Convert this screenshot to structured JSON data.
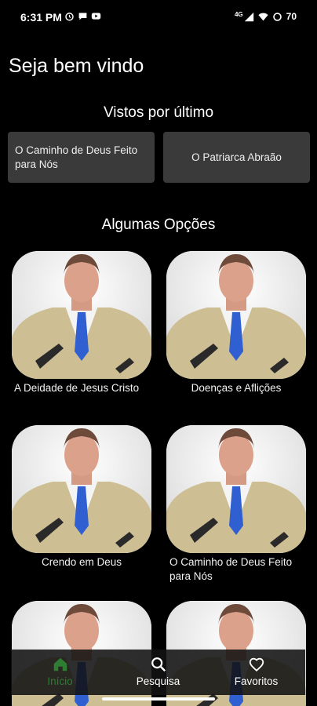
{
  "status_bar": {
    "time": "6:31 PM",
    "left_icons": [
      "alarm-icon",
      "chat-icon",
      "youtube-icon"
    ],
    "right_icons": [
      "signal-icon",
      "wifi-icon",
      "battery-icon"
    ],
    "network": "4G",
    "battery": "70"
  },
  "header": {
    "welcome": "Seja bem vindo"
  },
  "recent": {
    "title": "Vistos por último",
    "items": [
      "O Caminho de Deus Feito para Nós",
      "O Patriarca Abraão"
    ]
  },
  "options": {
    "title": "Algumas Opções",
    "items": [
      {
        "label": "A Deidade de Jesus Cristo"
      },
      {
        "label": "Doenças e Aflições"
      },
      {
        "label": "Crendo em Deus"
      },
      {
        "label": "O Caminho de Deus Feito para Nós"
      },
      {
        "label": ""
      },
      {
        "label": ""
      }
    ]
  },
  "bottom_nav": {
    "items": [
      {
        "label": "Início",
        "icon": "home-icon",
        "active": true
      },
      {
        "label": "Pesquisa",
        "icon": "search-icon",
        "active": false
      },
      {
        "label": "Favoritos",
        "icon": "heart-icon",
        "active": false
      }
    ]
  },
  "colors": {
    "background": "#000000",
    "card": "#3a3a3a",
    "accent": "#2e7d32"
  }
}
